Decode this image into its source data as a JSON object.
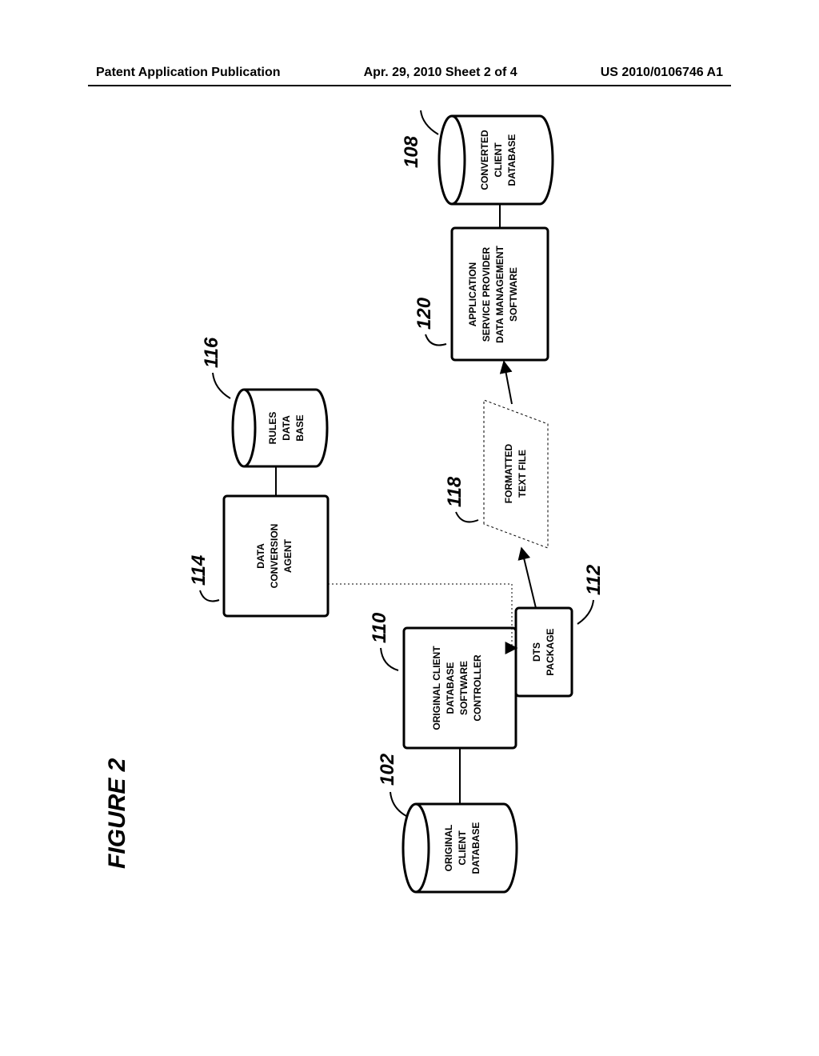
{
  "header": {
    "left": "Patent Application Publication",
    "center": "Apr. 29, 2010  Sheet 2 of 4",
    "right": "US 2010/0106746 A1"
  },
  "figure": {
    "label": "FIGURE 2",
    "nodes": {
      "original_db": {
        "ref": "102",
        "line1": "ORIGINAL",
        "line2": "CLIENT",
        "line3": "DATABASE"
      },
      "controller": {
        "ref": "110",
        "line1": "ORIGINAL CLIENT",
        "line2": "DATABASE",
        "line3": "SOFTWARE",
        "line4": "CONTROLLER"
      },
      "dts": {
        "ref": "112",
        "line1": "DTS",
        "line2": "PACKAGE"
      },
      "agent": {
        "ref": "114",
        "line1": "DATA",
        "line2": "CONVERSION",
        "line3": "AGENT"
      },
      "rules": {
        "ref": "116",
        "line1": "RULES",
        "line2": "DATA",
        "line3": "BASE"
      },
      "textfile": {
        "ref": "118",
        "line1": "FORMATTED",
        "line2": "TEXT FILE"
      },
      "asp": {
        "ref": "120",
        "line1": "APPLICATION",
        "line2": "SERVICE PROVIDER",
        "line3": "DATA MANAGEMENT",
        "line4": "SOFTWARE"
      },
      "converted": {
        "ref": "108",
        "line1": "CONVERTED",
        "line2": "CLIENT",
        "line3": "DATABASE"
      }
    }
  }
}
